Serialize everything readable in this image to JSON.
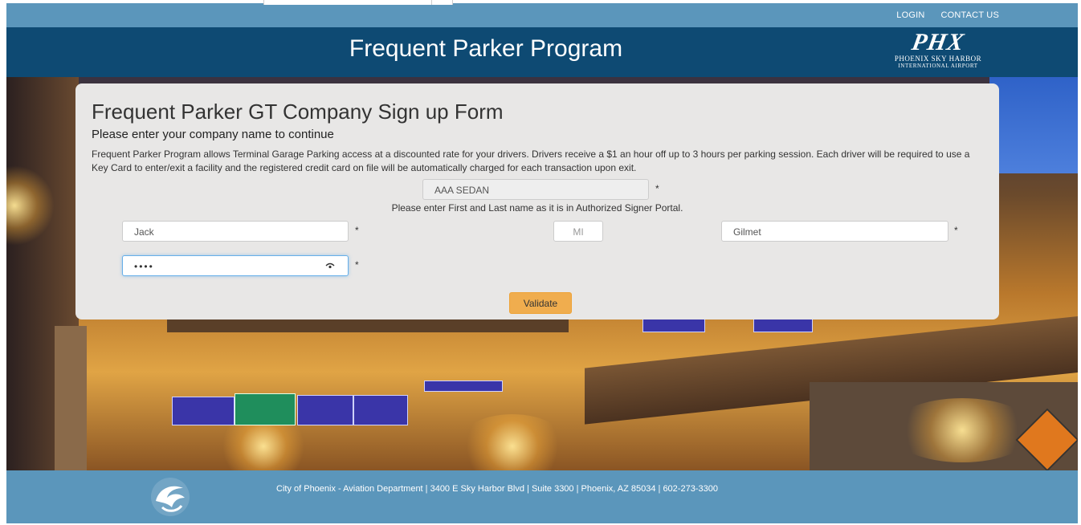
{
  "topbar": {
    "login": "LOGIN",
    "contact": "CONTACT US"
  },
  "header": {
    "title": "Frequent Parker Program",
    "logo_mark": "PHX",
    "logo_line1": "PHOENIX SKY HARBOR",
    "logo_line2": "INTERNATIONAL AIRPORT"
  },
  "form": {
    "heading": "Frequent Parker GT Company Sign up Form",
    "subheading": "Please enter your company name to continue",
    "description": "Frequent Parker Program allows Terminal Garage Parking access at a discounted rate for your drivers. Drivers receive a $1 an hour off up to 3 hours per parking session. Each driver will be required to use a Key Card to enter/exit a facility and the registered credit card on file will be automatically charged for each transaction upon exit.",
    "company": {
      "value": "AAA SEDAN"
    },
    "name_hint": "Please enter First and Last name as it is in Authorized Signer Portal.",
    "first_name": {
      "value": "Jack"
    },
    "middle_initial": {
      "placeholder": "MI"
    },
    "last_name": {
      "value": "Gilmet"
    },
    "password": {
      "masked": "••••"
    },
    "required_marker": "*",
    "validate_label": "Validate"
  },
  "footer": {
    "address": "City of Phoenix - Aviation Department | 3400 E Sky Harbor Blvd | Suite 3300 | Phoenix, AZ 85034 | 602-273-3300"
  },
  "icons": {
    "password_reveal": "eye-icon",
    "city_logo": "phoenix-bird-icon"
  },
  "colors": {
    "topbar": "#5b96bb",
    "header": "#0e4a73",
    "validate": "#f0ad4e"
  }
}
